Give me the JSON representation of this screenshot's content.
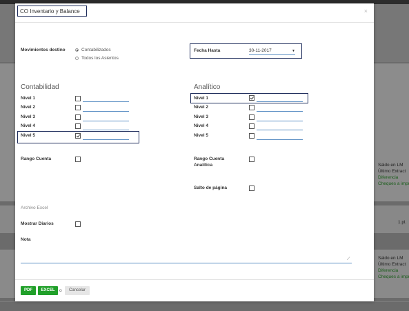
{
  "modal": {
    "title": "CO Inventario y Balance",
    "close": "×"
  },
  "movimientos": {
    "label": "Movimientos destino",
    "options": [
      "Contabilizados",
      "Todos los Asientos"
    ],
    "selected": "Contabilizados"
  },
  "fecha_hasta": {
    "label": "Fecha Hasta",
    "value": "30-11-2017"
  },
  "contabilidad": {
    "title": "Contabilidad",
    "levels": [
      {
        "label": "Nivel 1",
        "checked": false
      },
      {
        "label": "Nivel 2",
        "checked": false
      },
      {
        "label": "Nivel 3",
        "checked": false
      },
      {
        "label": "Nivel 4",
        "checked": false
      },
      {
        "label": "Nivel 5",
        "checked": true
      }
    ],
    "rango_label": "Rango Cuenta"
  },
  "analitico": {
    "title": "Analítico",
    "levels": [
      {
        "label": "Nivel 1",
        "checked": true
      },
      {
        "label": "Nivel 2",
        "checked": false
      },
      {
        "label": "Nivel 3",
        "checked": false
      },
      {
        "label": "Nivel 4",
        "checked": false
      },
      {
        "label": "Nivel 5",
        "checked": false
      }
    ],
    "rango_label_line1": "Rango Cuenta",
    "rango_label_line2": "Analítica",
    "salto_label": "Salto de página"
  },
  "archivo_excel_label": "Archivo Excel",
  "mostrar_diarios_label": "Mostrar Diarios",
  "nota_label": "Nota",
  "footer": {
    "pdf_label": "PDF",
    "excel_label": "EXCEL",
    "or_label": "o",
    "cancel_label": "Cancelar"
  },
  "background": {
    "saldo": "Saldo en LM",
    "ultimo": "Último Extract",
    "diferencia": "Diferencia",
    "cheques": "Cheques a impr",
    "count": "1 pl."
  }
}
